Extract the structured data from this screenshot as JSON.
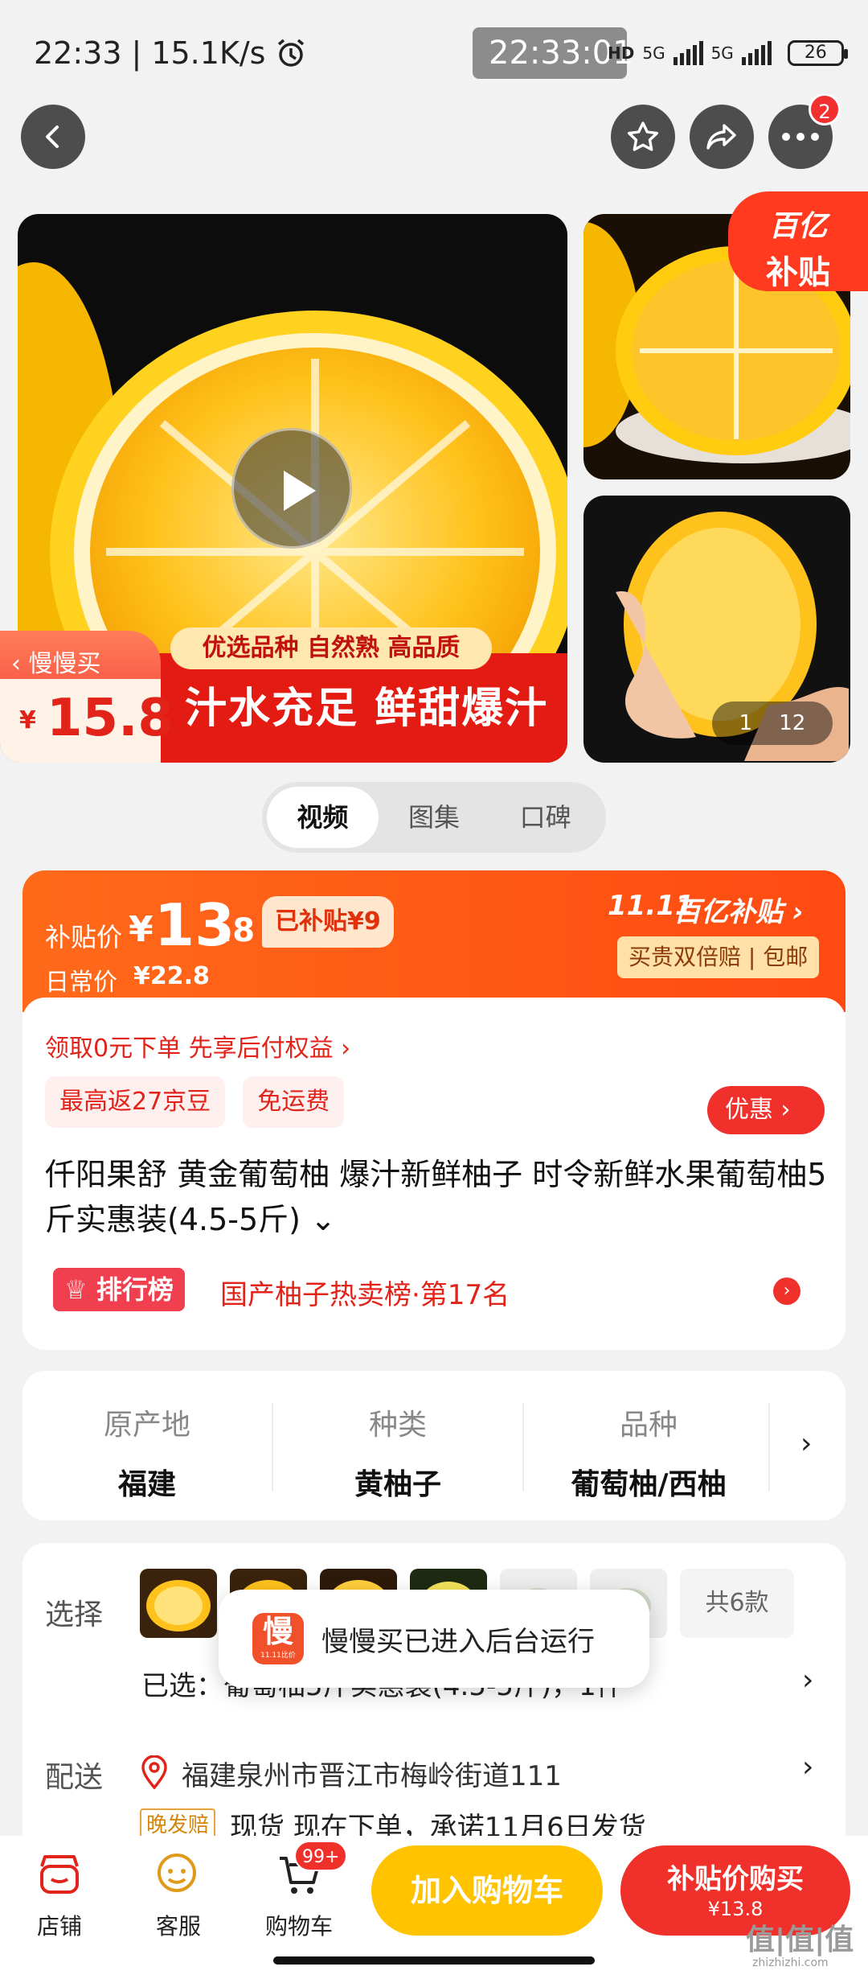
{
  "status_bar": {
    "time": "22:33",
    "net_speed": "15.1K/s",
    "center_time": "22:33:01",
    "hd_label": "HD",
    "net1": "5G",
    "net2": "5G",
    "battery": "26"
  },
  "nav": {
    "cart_badge_count": "2"
  },
  "gallery": {
    "promo_tag_line1": "百亿",
    "promo_tag_line2": "补贴",
    "slow_buy_label": "慢慢买",
    "slow_buy_price_symbol": "¥",
    "slow_buy_price": "15.8",
    "banner_small": "优选品种 自然熟 高品质",
    "banner_big": "汁水充足 鲜甜爆汁",
    "counter_current": "1",
    "counter_total": "12"
  },
  "media_tabs": [
    {
      "label": "视频"
    },
    {
      "label": "图集"
    },
    {
      "label": "口碑"
    }
  ],
  "price": {
    "subsidy_label": "补贴价",
    "currency": "¥",
    "subsidy_int": "13",
    "subsidy_dec": ".8",
    "subsidized_tag": "已补贴¥9",
    "daily_label": "日常价",
    "daily_price": "¥22.8",
    "event_label": "11.11",
    "event_brand": "百亿补贴",
    "guarantee": "买贵双倍赔 | 包邮"
  },
  "info": {
    "pay_later": "领取0元下单 先享后付权益 ›",
    "tag1": "最高返27京豆",
    "tag2": "免运费",
    "discount_btn": "优惠",
    "title": "仟阳果舒 黄金葡萄柚 爆汁新鲜柚子 时令新鲜水果葡萄柚5斤实惠装(4.5-5斤)",
    "rank_badge": "排行榜",
    "rank_text": "国产柚子热卖榜·第17名"
  },
  "specs": [
    {
      "key": "原产地",
      "value": "福建"
    },
    {
      "key": "种类",
      "value": "黄柚子"
    },
    {
      "key": "品种",
      "value": "葡萄柚/西柚"
    }
  ],
  "options": {
    "select_label": "选择",
    "total_count": "共6款",
    "selected_text": "已选：葡萄柚5斤实惠装(4.5-5斤)，1件",
    "delivery_label": "配送",
    "address": "福建泉州市晋江市梅岭街道111",
    "late_ship_tag": "晚发赔",
    "stock_text": "现货   现在下单，承诺11月6日发货"
  },
  "toast": {
    "icon_char": "慢",
    "icon_sub": "11.11比价",
    "message": "慢慢买已进入后台运行"
  },
  "bottom_bar": {
    "store": "店铺",
    "service": "客服",
    "cart": "购物车",
    "cart_badge": "99+",
    "add_to_cart": "加入购物车",
    "buy_now": "补贴价购买",
    "buy_price": "¥13.8",
    "watermark": "值|值|值",
    "watermark_url": "zhizhizhi.com"
  },
  "colors": {
    "accent_red": "#f0302a",
    "accent_orange": "#ff5a14",
    "yellow_button": "#ffc300"
  }
}
